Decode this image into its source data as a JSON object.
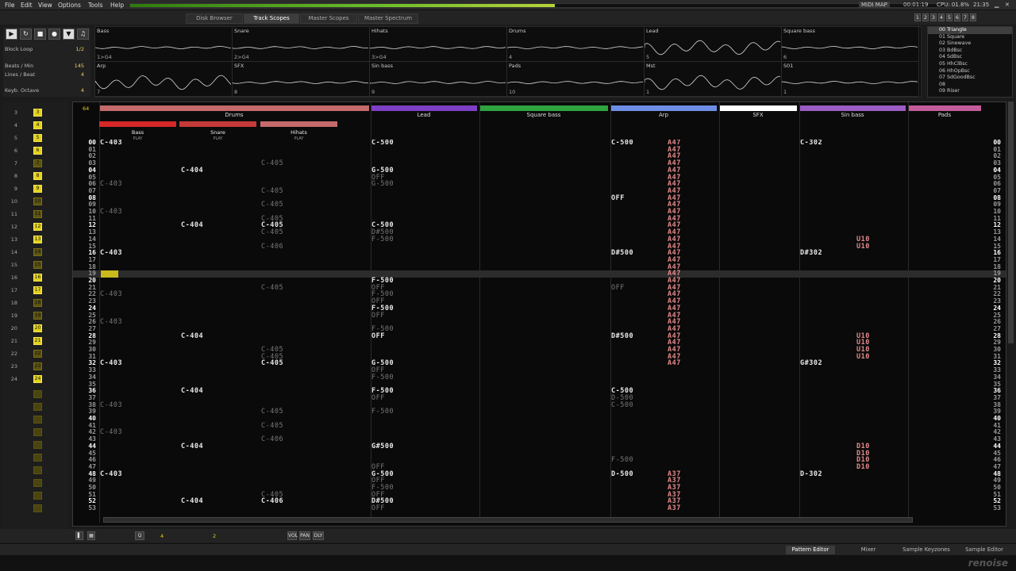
{
  "menu": [
    "File",
    "Edit",
    "View",
    "Options",
    "Tools",
    "Help"
  ],
  "status": {
    "midi_map": "MIDI MAP",
    "time": "00:01:19",
    "cpu": "CPU: 01.8%",
    "clock": "21:35"
  },
  "upper_tabs": [
    "Disk Browser",
    "Track Scopes",
    "Master Scopes",
    "Master Spectrum"
  ],
  "active_upper_tab": "Track Scopes",
  "num_buttons": [
    "1",
    "2",
    "3",
    "4",
    "5",
    "6",
    "7",
    "8"
  ],
  "transport": {
    "block_loop_label": "Block Loop",
    "block_loop_value": "1/2",
    "bpm_label": "Beats / Min",
    "bpm": "145",
    "lpb_label": "Lines / Beat",
    "lpb": "4",
    "octave_label": "Keyb. Octave",
    "octave": "4"
  },
  "scopes": [
    {
      "name": "Bass",
      "index": "1>G4"
    },
    {
      "name": "Snare",
      "index": "2>G4"
    },
    {
      "name": "Hihats",
      "index": "3>G4"
    },
    {
      "name": "Drums",
      "index": "4"
    },
    {
      "name": "Lead",
      "index": "5"
    },
    {
      "name": "Square bass",
      "index": "6"
    },
    {
      "name": "Arp",
      "index": "7"
    },
    {
      "name": "SFX",
      "index": "8"
    },
    {
      "name": "Sin bass",
      "index": "9"
    },
    {
      "name": "Pads",
      "index": "10"
    },
    {
      "name": "Mst",
      "index": "1"
    },
    {
      "name": "S01",
      "index": "1"
    }
  ],
  "instruments": [
    "00 Triangle",
    "01 Square",
    "02 Sinewave",
    "03 BdBsc",
    "04 SdBsc",
    "05 HhClBsc",
    "06 HhOpBsc",
    "07 SdGoodBsc",
    "08",
    "09 Riser"
  ],
  "selected_instrument": 0,
  "sequence": [
    {
      "n": "3",
      "b": "3",
      "lit": true
    },
    {
      "n": "4",
      "b": "4",
      "lit": true
    },
    {
      "n": "5",
      "b": "5",
      "lit": true
    },
    {
      "n": "6",
      "b": "6",
      "lit": true
    },
    {
      "n": "7",
      "b": "7",
      "lit": false
    },
    {
      "n": "8",
      "b": "8",
      "lit": true
    },
    {
      "n": "9",
      "b": "9",
      "lit": true
    },
    {
      "n": "10",
      "b": "10",
      "lit": false
    },
    {
      "n": "11",
      "b": "11",
      "lit": false
    },
    {
      "n": "12",
      "b": "12",
      "lit": true
    },
    {
      "n": "13",
      "b": "13",
      "lit": true
    },
    {
      "n": "14",
      "b": "14",
      "lit": false
    },
    {
      "n": "15",
      "b": "15",
      "lit": false
    },
    {
      "n": "16",
      "b": "16",
      "lit": true
    },
    {
      "n": "17",
      "b": "17",
      "lit": true
    },
    {
      "n": "18",
      "b": "18",
      "lit": false
    },
    {
      "n": "19",
      "b": "19",
      "lit": false
    },
    {
      "n": "20",
      "b": "20",
      "lit": true
    },
    {
      "n": "21",
      "b": "21",
      "lit": true
    },
    {
      "n": "22",
      "b": "22",
      "lit": false
    },
    {
      "n": "23",
      "b": "23",
      "lit": false
    },
    {
      "n": "24",
      "b": "24",
      "lit": true
    }
  ],
  "pattern_length": "64",
  "tracks": [
    {
      "name": "Drums",
      "color": "#c46a6a"
    },
    {
      "name": "Lead",
      "color": "#7d3fc4"
    },
    {
      "name": "Square bass",
      "color": "#2fa33f"
    },
    {
      "name": "Arp",
      "color": "#6e8ee6"
    },
    {
      "name": "SFX",
      "color": "#ffffff"
    },
    {
      "name": "Sin bass",
      "color": "#9b5cc4"
    },
    {
      "name": "Pads",
      "color": "#c45b9b"
    }
  ],
  "subtracks": [
    {
      "name": "Bass",
      "color": "#d62828"
    },
    {
      "name": "Snare",
      "color": "#c43a3a"
    },
    {
      "name": "Hihats",
      "color": "#c46a6a"
    }
  ],
  "play_label": "PLAY",
  "line_numbers": [
    "00",
    "01",
    "02",
    "03",
    "04",
    "05",
    "06",
    "07",
    "08",
    "09",
    "10",
    "11",
    "12",
    "13",
    "14",
    "15",
    "16",
    "17",
    "18",
    "19",
    "20",
    "21",
    "22",
    "23",
    "24",
    "25",
    "26",
    "27",
    "28",
    "29",
    "30",
    "31",
    "32",
    "33",
    "34",
    "35",
    "36",
    "37",
    "38",
    "39",
    "40",
    "41",
    "42",
    "43",
    "44",
    "45",
    "46",
    "47",
    "48",
    "49",
    "50",
    "51",
    "52",
    "53"
  ],
  "notes": [
    {
      "col": "bass",
      "row": 0,
      "t": "C-403"
    },
    {
      "col": "bass",
      "row": 6,
      "t": "C-403",
      "g": 1
    },
    {
      "col": "bass",
      "row": 10,
      "t": "C-403",
      "g": 1
    },
    {
      "col": "bass",
      "row": 16,
      "t": "C-403"
    },
    {
      "col": "bass",
      "row": 22,
      "t": "C-403",
      "g": 1
    },
    {
      "col": "bass",
      "row": 26,
      "t": "C-403",
      "g": 1
    },
    {
      "col": "bass",
      "row": 32,
      "t": "C-403"
    },
    {
      "col": "bass",
      "row": 38,
      "t": "C-403",
      "g": 1
    },
    {
      "col": "bass",
      "row": 42,
      "t": "C-403",
      "g": 1
    },
    {
      "col": "bass",
      "row": 48,
      "t": "C-403"
    },
    {
      "col": "snare",
      "row": 4,
      "t": "C-404"
    },
    {
      "col": "snare",
      "row": 12,
      "t": "C-404"
    },
    {
      "col": "snare",
      "row": 28,
      "t": "C-404"
    },
    {
      "col": "snare",
      "row": 36,
      "t": "C-404"
    },
    {
      "col": "snare",
      "row": 44,
      "t": "C-404"
    },
    {
      "col": "snare",
      "row": 52,
      "t": "C-404"
    },
    {
      "col": "hihat",
      "row": 3,
      "t": "C-405",
      "g": 1
    },
    {
      "col": "hihat",
      "row": 7,
      "t": "C-405",
      "g": 1
    },
    {
      "col": "hihat",
      "row": 9,
      "t": "C-405",
      "g": 1
    },
    {
      "col": "hihat",
      "row": 11,
      "t": "C-405",
      "g": 1
    },
    {
      "col": "hihat",
      "row": 12,
      "t": "C-405"
    },
    {
      "col": "hihat",
      "row": 13,
      "t": "C-405",
      "g": 1
    },
    {
      "col": "hihat",
      "row": 15,
      "t": "C-406",
      "g": 1
    },
    {
      "col": "hihat",
      "row": 21,
      "t": "C-405",
      "g": 1
    },
    {
      "col": "hihat",
      "row": 30,
      "t": "C-405",
      "g": 1
    },
    {
      "col": "hihat",
      "row": 31,
      "t": "C-405",
      "g": 1
    },
    {
      "col": "hihat",
      "row": 32,
      "t": "C-405"
    },
    {
      "col": "hihat",
      "row": 39,
      "t": "C-405",
      "g": 1
    },
    {
      "col": "hihat",
      "row": 41,
      "t": "C-405",
      "g": 1
    },
    {
      "col": "hihat",
      "row": 43,
      "t": "C-406",
      "g": 1
    },
    {
      "col": "hihat",
      "row": 51,
      "t": "C-405",
      "g": 1
    },
    {
      "col": "hihat",
      "row": 52,
      "t": "C-406"
    },
    {
      "col": "lead",
      "row": 0,
      "t": "C-500"
    },
    {
      "col": "lead",
      "row": 4,
      "t": "G-500"
    },
    {
      "col": "lead",
      "row": 5,
      "t": "OFF",
      "g": 1
    },
    {
      "col": "lead",
      "row": 6,
      "t": "G-500",
      "g": 1
    },
    {
      "col": "lead",
      "row": 12,
      "t": "C-500"
    },
    {
      "col": "lead",
      "row": 13,
      "t": "D#500",
      "g": 1
    },
    {
      "col": "lead",
      "row": 14,
      "t": "F-500",
      "g": 1
    },
    {
      "col": "lead",
      "row": 20,
      "t": "F-500"
    },
    {
      "col": "lead",
      "row": 21,
      "t": "OFF",
      "g": 1
    },
    {
      "col": "lead",
      "row": 22,
      "t": "F-500",
      "g": 1
    },
    {
      "col": "lead",
      "row": 23,
      "t": "OFF",
      "g": 1
    },
    {
      "col": "lead",
      "row": 24,
      "t": "F-500"
    },
    {
      "col": "lead",
      "row": 25,
      "t": "OFF",
      "g": 1
    },
    {
      "col": "lead",
      "row": 27,
      "t": "F-500",
      "g": 1
    },
    {
      "col": "lead",
      "row": 28,
      "t": "OFF"
    },
    {
      "col": "lead",
      "row": 32,
      "t": "G-500"
    },
    {
      "col": "lead",
      "row": 33,
      "t": "OFF",
      "g": 1
    },
    {
      "col": "lead",
      "row": 34,
      "t": "F-500",
      "g": 1
    },
    {
      "col": "lead",
      "row": 36,
      "t": "F-500"
    },
    {
      "col": "lead",
      "row": 37,
      "t": "OFF",
      "g": 1
    },
    {
      "col": "lead",
      "row": 39,
      "t": "F-500",
      "g": 1
    },
    {
      "col": "lead",
      "row": 44,
      "t": "G#500"
    },
    {
      "col": "lead",
      "row": 47,
      "t": "OFF",
      "g": 1
    },
    {
      "col": "lead",
      "row": 48,
      "t": "G-500"
    },
    {
      "col": "lead",
      "row": 49,
      "t": "OFF",
      "g": 1
    },
    {
      "col": "lead",
      "row": 50,
      "t": "F-500",
      "g": 1
    },
    {
      "col": "lead",
      "row": 51,
      "t": "OFF",
      "g": 1
    },
    {
      "col": "lead",
      "row": 52,
      "t": "D#500"
    },
    {
      "col": "lead",
      "row": 53,
      "t": "OFF",
      "g": 1
    },
    {
      "col": "arp",
      "row": 0,
      "t": "C-500"
    },
    {
      "col": "arp",
      "row": 8,
      "t": "OFF"
    },
    {
      "col": "arp",
      "row": 16,
      "t": "D#500"
    },
    {
      "col": "arp",
      "row": 21,
      "t": "OFF",
      "g": 1
    },
    {
      "col": "arp",
      "row": 28,
      "t": "D#500"
    },
    {
      "col": "arp",
      "row": 36,
      "t": "C-500"
    },
    {
      "col": "arp",
      "row": 37,
      "t": "D-500",
      "g": 1
    },
    {
      "col": "arp",
      "row": 38,
      "t": "C-500",
      "g": 1
    },
    {
      "col": "arp",
      "row": 46,
      "t": "F-500",
      "g": 1
    },
    {
      "col": "arp",
      "row": 48,
      "t": "D-500"
    },
    {
      "col": "sqb",
      "row": 0,
      "t": "C-302"
    },
    {
      "col": "sqb",
      "row": 16,
      "t": "D#302"
    },
    {
      "col": "sqb",
      "row": 32,
      "t": "G#302"
    },
    {
      "col": "sqb",
      "row": 48,
      "t": "D-302"
    }
  ],
  "fx_a47": "A47",
  "fx_a37": "A37",
  "fx_u10": "U10",
  "fx_d10": "D10",
  "bottom_tabs": [
    "Pattern Editor",
    "Mixer",
    "Sample Keyzones",
    "Sample Editor"
  ],
  "active_bottom_tab": "Pattern Editor",
  "status_buttons": [
    "VOL",
    "PAN",
    "DLY"
  ],
  "step_values": [
    "4",
    "2"
  ],
  "brand": "renoise"
}
